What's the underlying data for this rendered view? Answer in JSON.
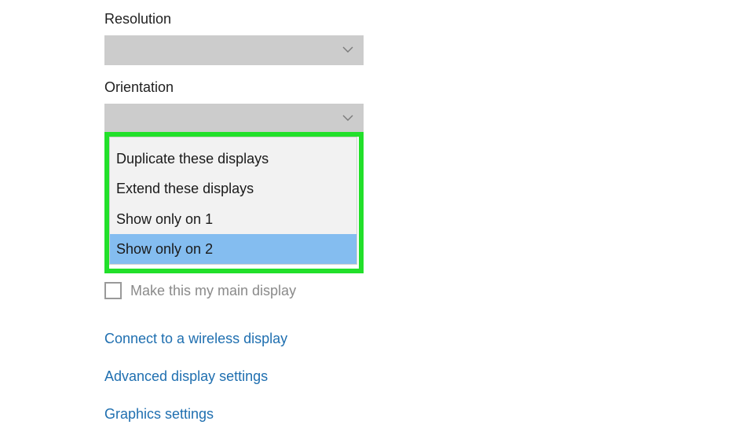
{
  "resolution": {
    "label": "Resolution",
    "value": ""
  },
  "orientation": {
    "label": "Orientation",
    "value": ""
  },
  "multiple_displays": {
    "options": [
      "Duplicate these displays",
      "Extend these displays",
      "Show only on 1",
      "Show only on 2"
    ],
    "selected_index": 3
  },
  "main_display": {
    "label": "Make this my main display",
    "checked": false
  },
  "links": {
    "wireless": "Connect to a wireless display",
    "advanced": "Advanced display settings",
    "graphics": "Graphics settings"
  },
  "colors": {
    "highlight_border": "#22e02a",
    "selected_item": "#84bdf0",
    "link": "#1f6fb0",
    "dropdown_bg": "#cccccc"
  },
  "icons": {
    "dropdown": "chevron-down-icon"
  }
}
